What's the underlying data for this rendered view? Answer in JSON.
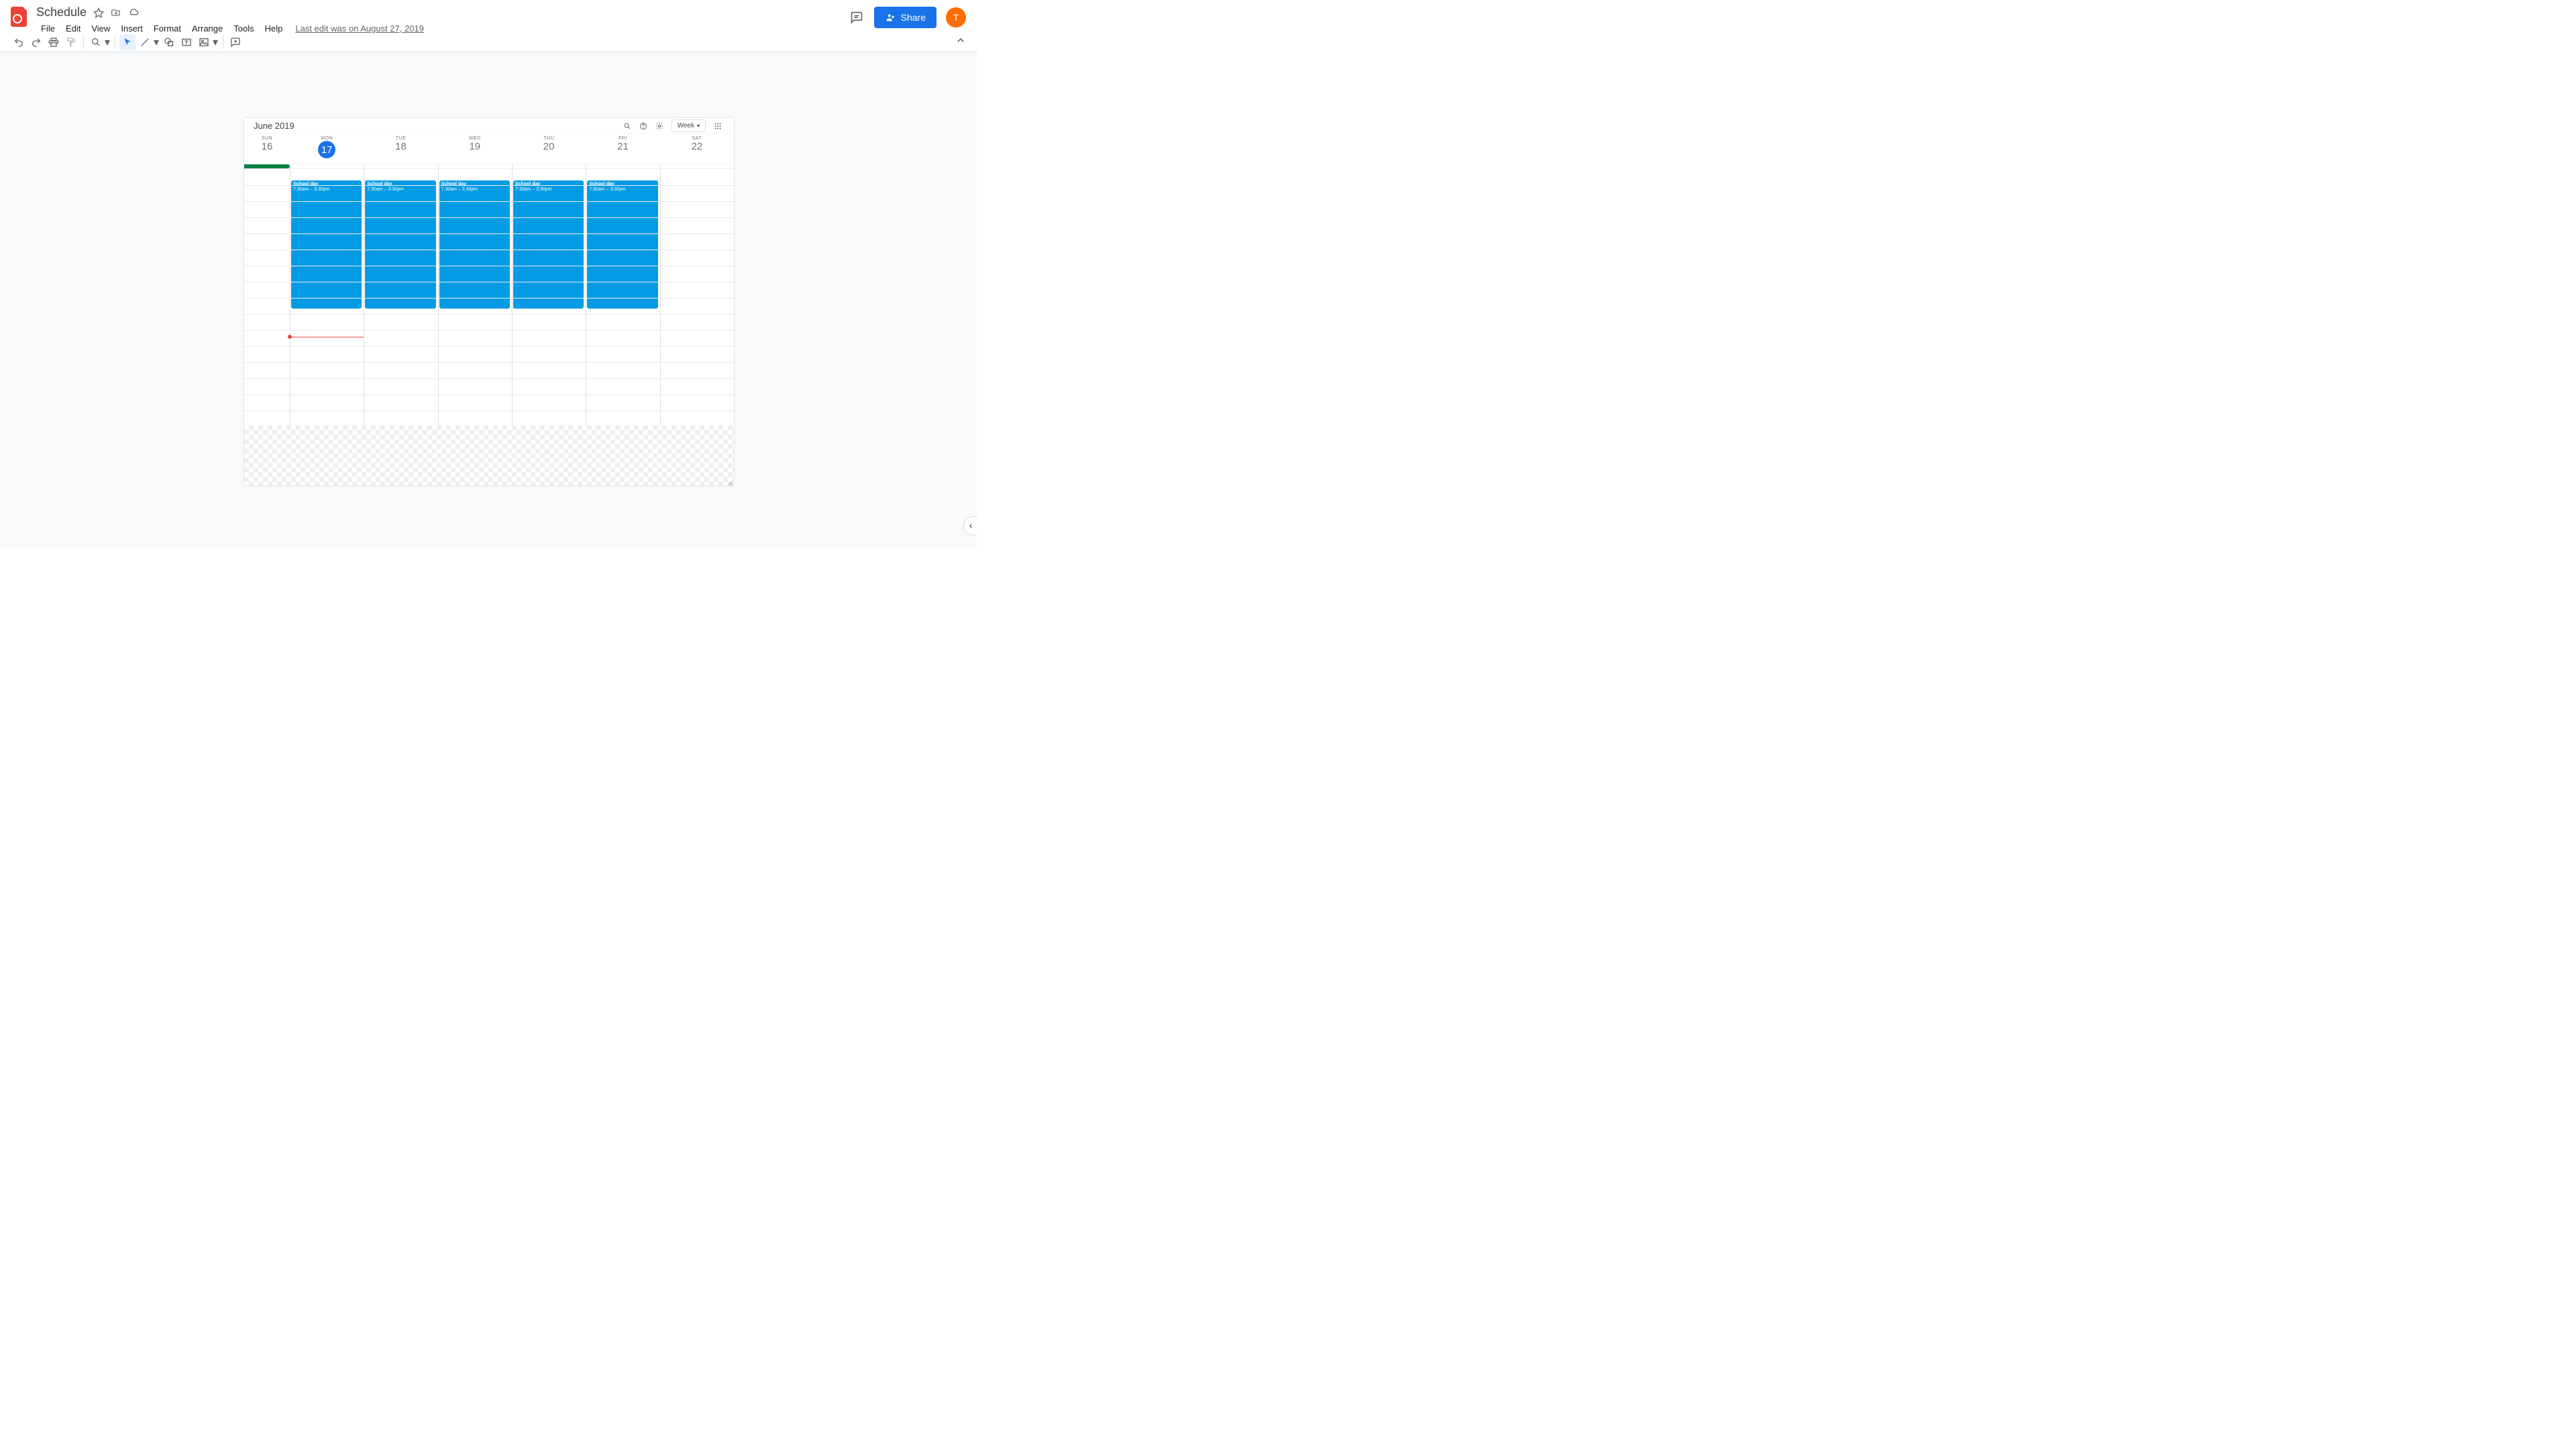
{
  "doc": {
    "title": "Schedule",
    "last_edit": "Last edit was on August 27, 2019"
  },
  "menus": [
    "File",
    "Edit",
    "View",
    "Insert",
    "Format",
    "Arrange",
    "Tools",
    "Help"
  ],
  "share_label": "Share",
  "avatar_initial": "T",
  "calendar": {
    "month_label": "June 2019",
    "view_label": "Week",
    "days": [
      {
        "abbr": "SUN",
        "num": "16",
        "today": false
      },
      {
        "abbr": "MON",
        "num": "17",
        "today": true
      },
      {
        "abbr": "TUE",
        "num": "18",
        "today": false
      },
      {
        "abbr": "WED",
        "num": "19",
        "today": false
      },
      {
        "abbr": "THU",
        "num": "20",
        "today": false
      },
      {
        "abbr": "FRI",
        "num": "21",
        "today": false
      },
      {
        "abbr": "SAT",
        "num": "22",
        "today": false
      }
    ],
    "event_title": "School day",
    "event_time": "7:30am – 3:30pm"
  }
}
